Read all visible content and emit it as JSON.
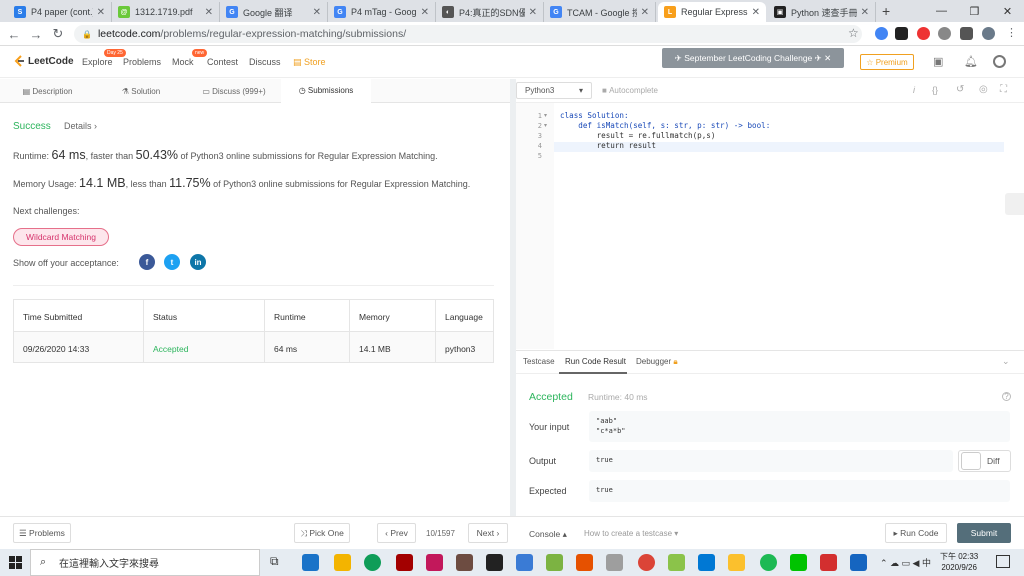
{
  "tabs": [
    {
      "title": "P4 paper (cont.) &",
      "color": "#2b7de9",
      "glyph": "S"
    },
    {
      "title": "1312.1719.pdf",
      "color": "#6ac93a",
      "glyph": "@"
    },
    {
      "title": "Google 翻译",
      "color": "#4285f4",
      "glyph": "G"
    },
    {
      "title": "P4 mTag - Google",
      "color": "#4285f4",
      "glyph": "G"
    },
    {
      "title": "P4:真正的SDN優",
      "color": "#555",
      "glyph": "◐"
    },
    {
      "title": "TCAM - Google 搜",
      "color": "#4285f4",
      "glyph": "G"
    },
    {
      "title": "Regular Expressio",
      "color": "#f89f1b",
      "glyph": "L"
    },
    {
      "title": "Python 速查手冊",
      "color": "#222",
      "glyph": "▣"
    }
  ],
  "url": {
    "host": "leetcode.com",
    "path": "/problems/regular-expression-matching/submissions/"
  },
  "header": {
    "logo": "LeetCode",
    "nav": [
      "Explore",
      "Problems",
      "Mock",
      "Contest",
      "Discuss",
      "Store"
    ],
    "explore_badge": "Day 25",
    "mock_badge": "new",
    "challenge": "September LeetCoding Challenge",
    "premium": "☆ Premium"
  },
  "left_tabs": [
    "Description",
    "Solution",
    "Discuss (999+)",
    "Submissions"
  ],
  "result": {
    "status": "Success",
    "details": "Details",
    "runtime_label": "Runtime:",
    "runtime": "64 ms",
    "runtime_mid": ", faster than",
    "runtime_pct": "50.43%",
    "runtime_tail": "of Python3 online submissions for Regular Expression Matching.",
    "mem_label": "Memory Usage:",
    "memory": "14.1 MB",
    "mem_mid": ", less than",
    "mem_pct": "11.75%",
    "mem_tail": "of Python3 online submissions for Regular Expression Matching.",
    "next": "Next challenges:",
    "next_item": "Wildcard Matching",
    "show_off": "Show off your acceptance:"
  },
  "table": {
    "headers": [
      "Time Submitted",
      "Status",
      "Runtime",
      "Memory",
      "Language"
    ],
    "row": [
      "09/26/2020 14:33",
      "Accepted",
      "64 ms",
      "14.1 MB",
      "python3"
    ]
  },
  "editor": {
    "language": "Python3",
    "autocomplete": "Autocomplete",
    "lines": [
      "class Solution:",
      "    def isMatch(self, s: str, p: str) -> bool:",
      "        result = re.fullmatch(p,s)",
      "        return result",
      ""
    ],
    "line_numbers": [
      "1",
      "2",
      "3",
      "4",
      "5"
    ]
  },
  "console": {
    "tabs": [
      "Testcase",
      "Run Code Result",
      "Debugger"
    ],
    "accepted": "Accepted",
    "runtime": "Runtime: 40 ms",
    "your_input_label": "Your input",
    "your_input": "\"aab\"\n\"c*a*b\"",
    "output_label": "Output",
    "output": "true",
    "diff": "Diff",
    "expected_label": "Expected",
    "expected": "true"
  },
  "bottom": {
    "problems": "Problems",
    "pick_one": "Pick One",
    "prev": "Prev",
    "counter": "10/1597",
    "next": "Next",
    "console": "Console",
    "howto": "How to create a testcase",
    "run_code": "Run Code",
    "submit": "Submit"
  },
  "taskbar": {
    "search_placeholder": "在這裡輸入文字來搜尋",
    "time": "下午 02:33",
    "date": "2020/9/26"
  }
}
